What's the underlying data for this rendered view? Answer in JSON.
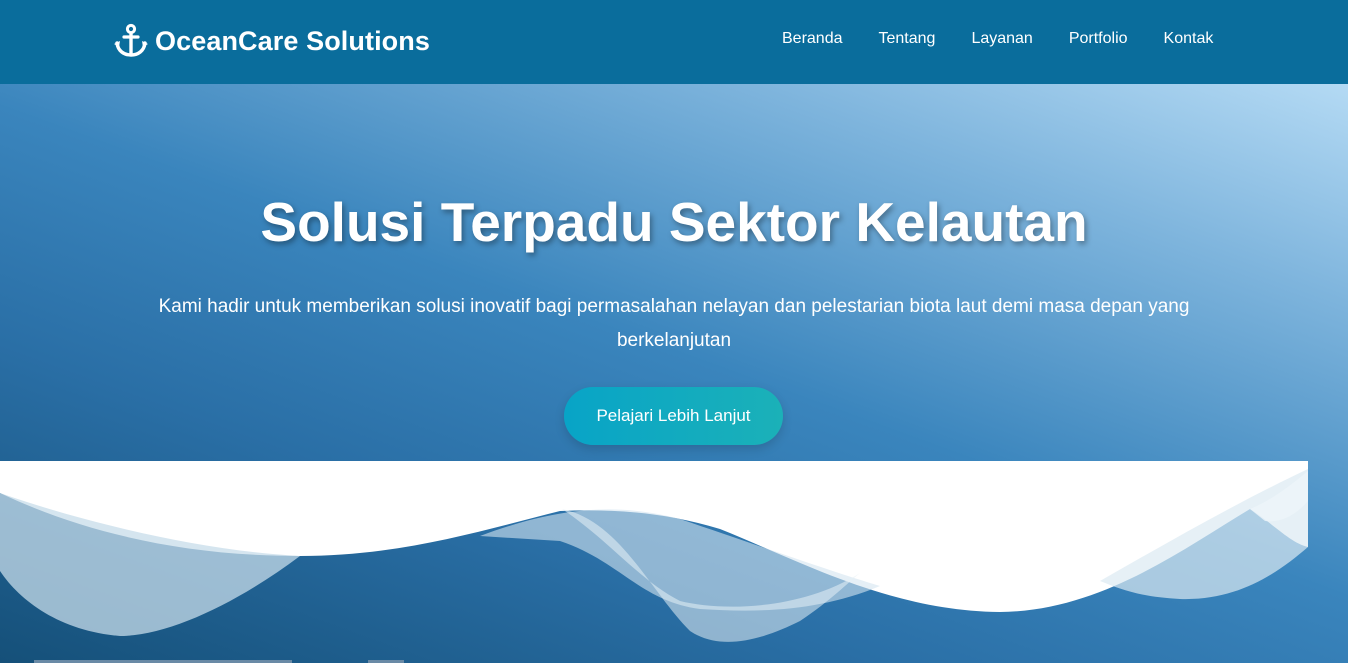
{
  "brand": {
    "name": "OceanCare Solutions",
    "icon": "anchor-icon"
  },
  "nav": {
    "items": [
      {
        "label": "Beranda"
      },
      {
        "label": "Tentang"
      },
      {
        "label": "Layanan"
      },
      {
        "label": "Portfolio"
      },
      {
        "label": "Kontak"
      }
    ]
  },
  "hero": {
    "title": "Solusi Terpadu Sektor Kelautan",
    "subtitle": "Kami hadir untuk memberikan solusi inovatif bagi permasalahan nelayan dan pelestarian biota laut demi masa depan yang berkelanjutan",
    "cta_label": "Pelajari Lebih Lanjut"
  },
  "colors": {
    "navbar": "#0a6d9c",
    "cta_start": "#08a4c7",
    "cta_end": "#1bb1b8",
    "text": "#ffffff"
  }
}
